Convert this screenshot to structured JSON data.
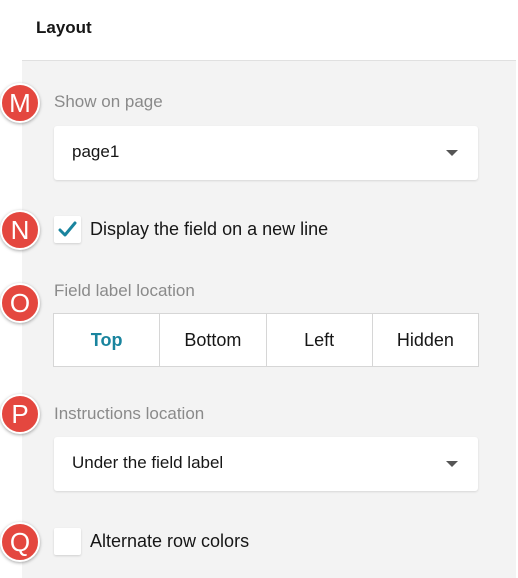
{
  "header": {
    "title": "Layout"
  },
  "markers": [
    "M",
    "N",
    "O",
    "P",
    "Q"
  ],
  "show_on_page": {
    "label": "Show on page",
    "value": "page1"
  },
  "new_line": {
    "label": "Display the field on a new line",
    "checked": true
  },
  "label_location": {
    "label": "Field label location",
    "options": [
      "Top",
      "Bottom",
      "Left",
      "Hidden"
    ],
    "selected": "Top"
  },
  "instructions": {
    "label": "Instructions location",
    "value": "Under the field label"
  },
  "alt_rows": {
    "label": "Alternate row colors",
    "checked": false
  },
  "colors": {
    "accent": "#19849e",
    "marker": "#e4473f",
    "panel": "#f3f3f3"
  }
}
